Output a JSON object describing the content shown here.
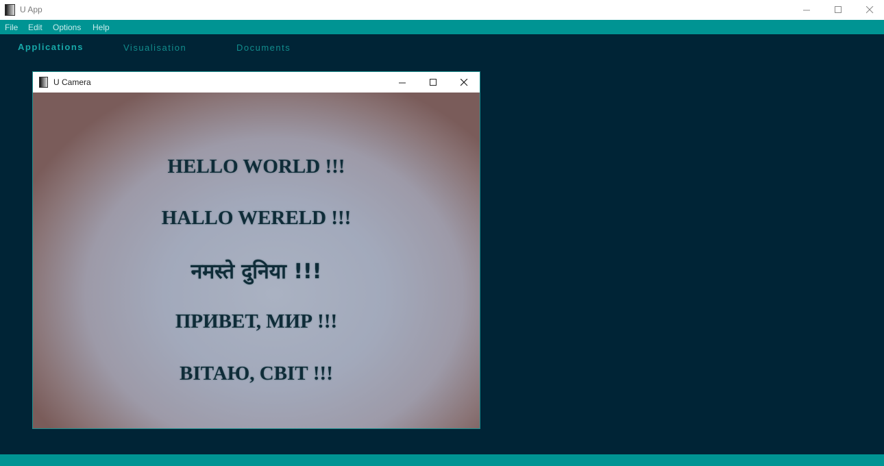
{
  "window": {
    "title": "U App",
    "minimize_icon": "minimize-icon",
    "maximize_icon": "maximize-icon",
    "close_icon": "close-icon"
  },
  "menu": {
    "items": [
      {
        "label": "File"
      },
      {
        "label": "Edit"
      },
      {
        "label": "Options"
      },
      {
        "label": "Help"
      }
    ]
  },
  "tabs": [
    {
      "label": "Applications",
      "active": true
    },
    {
      "label": "Visualisation",
      "active": false
    },
    {
      "label": "Documents",
      "active": false
    }
  ],
  "camera_window": {
    "title": "U Camera",
    "feed_lines": [
      "HELLO WORLD !!!",
      "HALLO WERELD !!!",
      "नमस्ते दुनिया !!!",
      "ПРИВЕТ, МИР !!!",
      "ВІТАЮ, СВІТ !!!"
    ]
  },
  "colors": {
    "background": "#002436",
    "accent": "#009493",
    "tab_text": "#128d8d"
  }
}
